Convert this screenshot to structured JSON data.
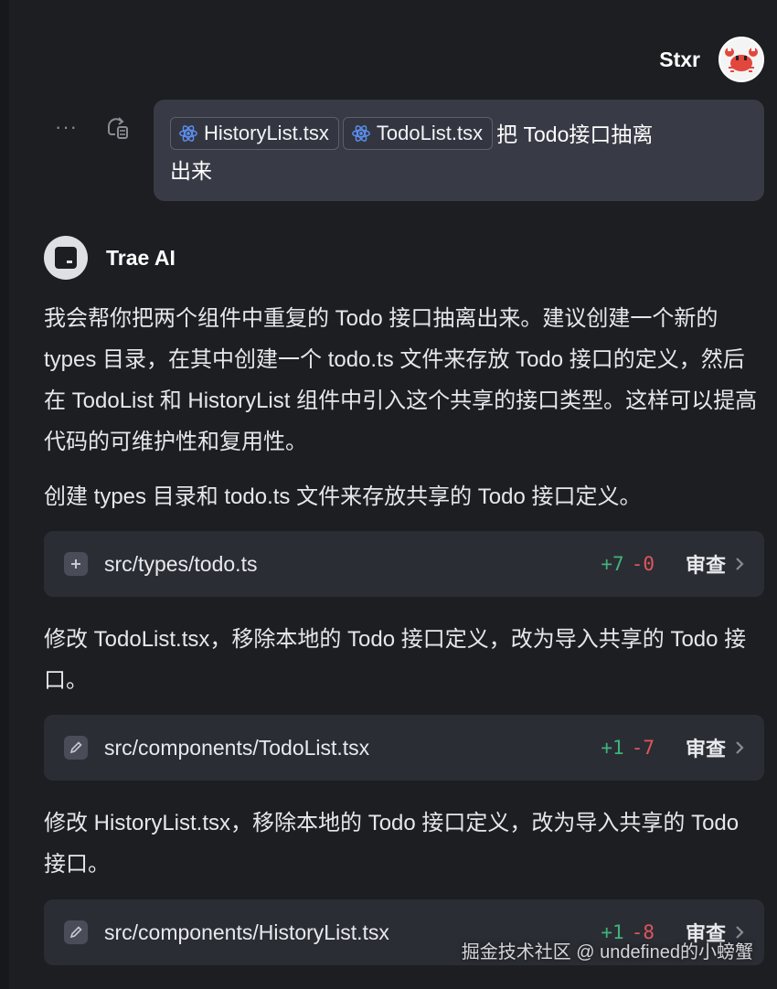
{
  "user": {
    "name": "Stxr"
  },
  "message": {
    "chips": [
      {
        "label": "HistoryList.tsx",
        "icon": "react-icon"
      },
      {
        "label": "TodoList.tsx",
        "icon": "react-icon"
      }
    ],
    "text_line1": "把 Todo接口抽离",
    "text_line2": "出来",
    "actions": {
      "more_icon": "ellipsis-icon",
      "resend_icon": "resend-icon"
    }
  },
  "assistant": {
    "name": "Trae AI",
    "intro": "我会帮你把两个组件中重复的 Todo 接口抽离出来。建议创建一个新的 types 目录，在其中创建一个 todo.ts 文件来存放 Todo 接口的定义，然后在 TodoList 和 HistoryList 组件中引入这个共享的接口类型。这样可以提高代码的可维护性和复用性。",
    "steps": [
      {
        "description": "创建 types 目录和 todo.ts 文件来存放共享的 Todo 接口定义。",
        "file": {
          "path": "src/types/todo.ts",
          "icon": "plus-icon",
          "added": "+7",
          "removed": "-0",
          "review_label": "审查"
        }
      },
      {
        "description": "修改 TodoList.tsx，移除本地的 Todo 接口定义，改为导入共享的 Todo 接口。",
        "file": {
          "path": "src/components/TodoList.tsx",
          "icon": "pencil-icon",
          "added": "+1",
          "removed": "-7",
          "review_label": "审查"
        }
      },
      {
        "description": "修改 HistoryList.tsx，移除本地的 Todo 接口定义，改为导入共享的 Todo 接口。",
        "file": {
          "path": "src/components/HistoryList.tsx",
          "icon": "pencil-icon",
          "added": "+1",
          "removed": "-8",
          "review_label": "审查"
        }
      }
    ]
  },
  "watermark": "掘金技术社区 @ undefined的小螃蟹",
  "colors": {
    "background": "#1d1e22",
    "bubble": "#383b46",
    "card": "#2b2d34",
    "diff_add": "#3fb37a",
    "diff_del": "#e0555d",
    "react_blue": "#5b8def"
  }
}
